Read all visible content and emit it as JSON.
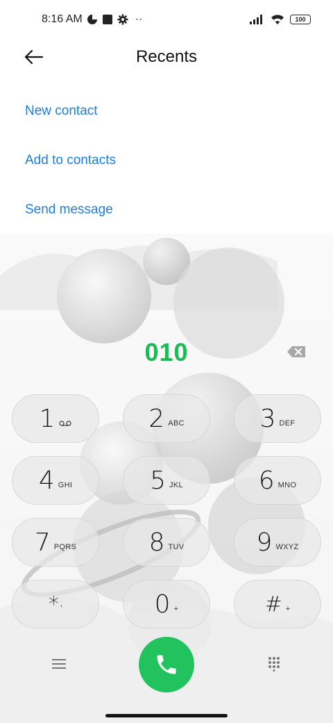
{
  "status_bar": {
    "time": "8:16 AM",
    "battery": "100",
    "more": "··",
    "icons": [
      "data-saver-icon",
      "square-icon",
      "gear-icon",
      "signal-icon",
      "wifi-icon",
      "battery-icon"
    ]
  },
  "header": {
    "title": "Recents",
    "back_icon": "arrow-left-icon"
  },
  "actions": {
    "new_contact": "New contact",
    "add_to_contacts": "Add to contacts",
    "send_message": "Send message"
  },
  "dialer": {
    "number": "010",
    "number_color": "#1db954",
    "backspace_icon": "backspace-icon"
  },
  "keypad": [
    {
      "digit": "1",
      "letters": "",
      "icon": "voicemail-icon"
    },
    {
      "digit": "2",
      "letters": "ABC"
    },
    {
      "digit": "3",
      "letters": "DEF"
    },
    {
      "digit": "4",
      "letters": "GHI"
    },
    {
      "digit": "5",
      "letters": "JKL"
    },
    {
      "digit": "6",
      "letters": "MNO"
    },
    {
      "digit": "7",
      "letters": "PQRS"
    },
    {
      "digit": "8",
      "letters": "TUV"
    },
    {
      "digit": "9",
      "letters": "WXYZ"
    },
    {
      "digit": "*",
      "letters": ","
    },
    {
      "digit": "0",
      "letters": "+"
    },
    {
      "digit": "#",
      "letters": "+"
    }
  ],
  "bottom_bar": {
    "menu_icon": "hamburger-icon",
    "call_icon": "phone-icon",
    "call_color": "#22c35e",
    "dialpad_icon": "dialpad-icon"
  },
  "colors": {
    "accent_link": "#1a7fe0",
    "number": "#1db954",
    "call": "#22c35e"
  }
}
